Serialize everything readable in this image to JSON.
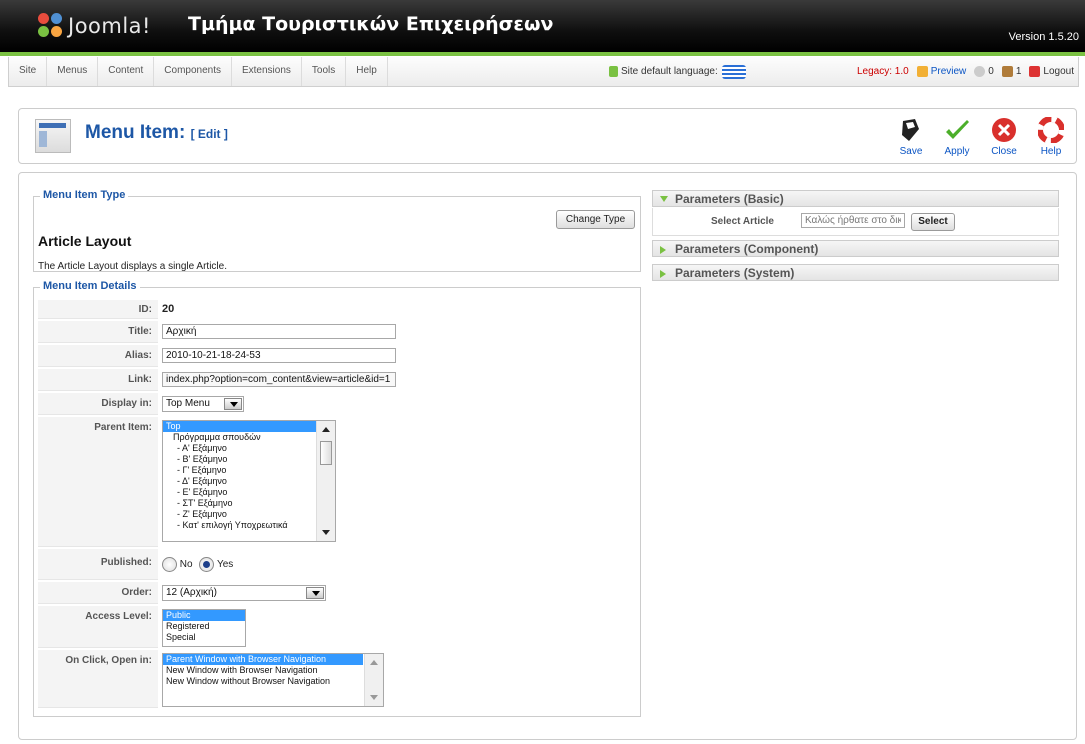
{
  "header": {
    "brand": "Joomla!",
    "site_name": "Τμήμα Τουριστικών Επιχειρήσεων",
    "version": "Version 1.5.20"
  },
  "menubar": {
    "items": [
      "Site",
      "Menus",
      "Content",
      "Components",
      "Extensions",
      "Tools",
      "Help"
    ],
    "site_language_label": "Site default language:",
    "legacy": "Legacy: 1.0",
    "preview": "Preview",
    "messages_count": "0",
    "users_count": "1",
    "logout": "Logout"
  },
  "toolbar": {
    "title": "Menu Item:",
    "title_action": "[ Edit ]",
    "save": "Save",
    "apply": "Apply",
    "close": "Close",
    "help": "Help"
  },
  "menu_item_type": {
    "legend": "Menu Item Type",
    "title": "Article Layout",
    "description": "The Article Layout displays a single Article.",
    "change_type": "Change Type"
  },
  "details": {
    "legend": "Menu Item Details",
    "id_label": "ID:",
    "id_value": "20",
    "title_label": "Title:",
    "title_value": "Αρχική",
    "alias_label": "Alias:",
    "alias_value": "2010-10-21-18-24-53",
    "link_label": "Link:",
    "link_value": "index.php?option=com_content&view=article&id=1",
    "display_label": "Display in:",
    "display_value": "Top Menu",
    "parent_label": "Parent Item:",
    "parent_options": [
      "Top",
      "Πρόγραμμα σπουδών",
      "- Α' Εξάμηνο",
      "- Β' Εξάμηνο",
      "- Γ' Εξάμηνο",
      "- Δ' Εξάμηνο",
      "- Ε' Εξάμηνο",
      "- ΣΤ' Εξάμηνο",
      "- Ζ' Εξάμηνο",
      "- Κατ' επιλογή Υποχρεωτικά"
    ],
    "published_label": "Published:",
    "published_no": "No",
    "published_yes": "Yes",
    "order_label": "Order:",
    "order_value": "12 (Αρχική)",
    "access_label": "Access Level:",
    "access_options": [
      "Public",
      "Registered",
      "Special"
    ],
    "onclick_label": "On Click, Open in:",
    "onclick_options": [
      "Parent Window with Browser Navigation",
      "New Window with Browser Navigation",
      "New Window without Browser Navigation"
    ]
  },
  "params": {
    "basic": "Parameters (Basic)",
    "select_article_label": "Select Article",
    "select_article_value": "Καλώς ήρθατε στο δικτ",
    "select_button": "Select",
    "component": "Parameters (Component)",
    "system": "Parameters (System)"
  },
  "colors": {
    "accent_green": "#7ac142",
    "title_blue": "#1d57a6",
    "selection_blue": "#3399ff"
  }
}
